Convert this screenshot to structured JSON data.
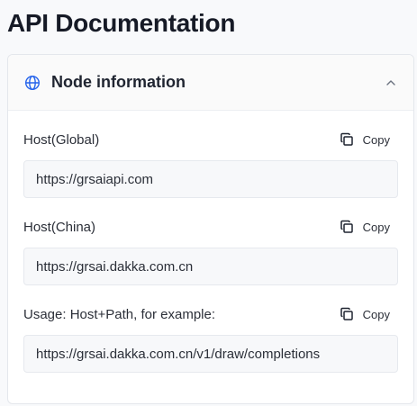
{
  "page": {
    "title": "API Documentation"
  },
  "card": {
    "title": "Node information",
    "icons": {
      "header": "globe-icon",
      "toggle": "chevron-up-icon",
      "copy": "copy-icon"
    },
    "accent_color": "#2563eb"
  },
  "fields": [
    {
      "label": "Host(Global)",
      "copy_label": "Copy",
      "value": "https://grsaiapi.com"
    },
    {
      "label": "Host(China)",
      "copy_label": "Copy",
      "value": "https://grsai.dakka.com.cn"
    },
    {
      "label": "Usage: Host+Path, for example:",
      "copy_label": "Copy",
      "value": "https://grsai.dakka.com.cn/v1/draw/completions"
    }
  ]
}
